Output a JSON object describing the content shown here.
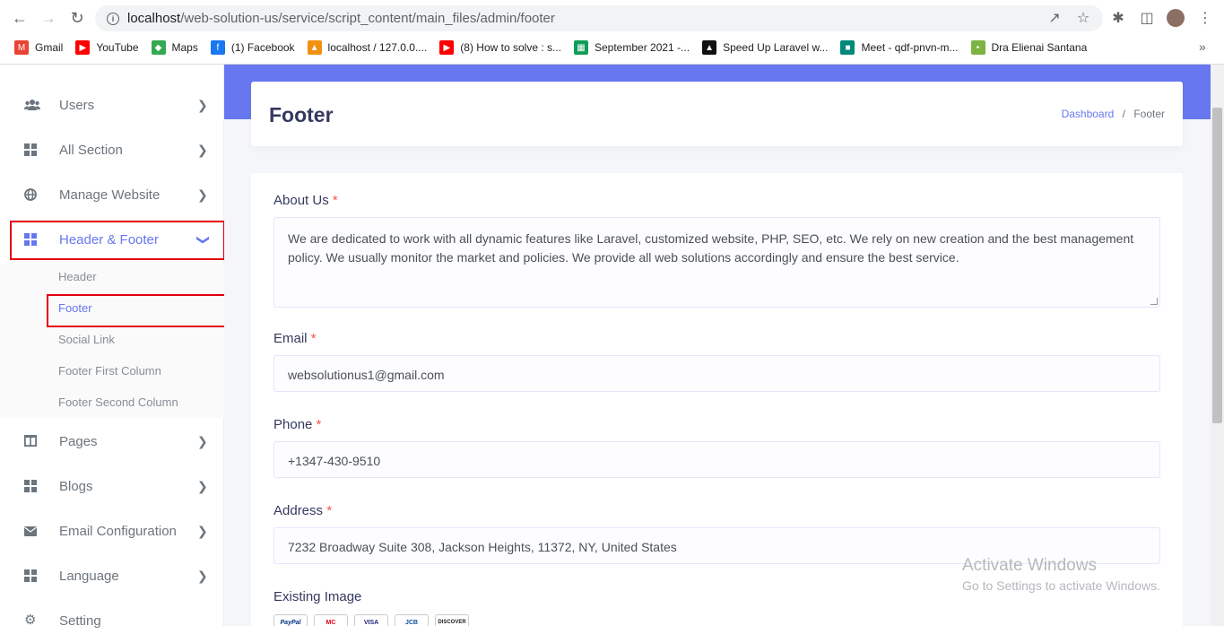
{
  "browser": {
    "url_host": "localhost",
    "url_path": "/web-solution-us/service/script_content/main_files/admin/footer",
    "bookmarks": [
      {
        "label": "Gmail",
        "icon": "gmail-icon",
        "color": "#ea4335"
      },
      {
        "label": "YouTube",
        "icon": "youtube-icon",
        "color": "#ff0000"
      },
      {
        "label": "Maps",
        "icon": "maps-icon",
        "color": "#34a853"
      },
      {
        "label": "(1) Facebook",
        "icon": "facebook-icon",
        "color": "#1877f2"
      },
      {
        "label": "localhost / 127.0.0....",
        "icon": "phpmyadmin-icon",
        "color": "#f29111"
      },
      {
        "label": "(8) How to solve : s...",
        "icon": "youtube-icon",
        "color": "#ff0000"
      },
      {
        "label": "September 2021 -...",
        "icon": "sheets-icon",
        "color": "#0f9d58"
      },
      {
        "label": "Speed Up Laravel w...",
        "icon": "laravel-icon",
        "color": "#111111"
      },
      {
        "label": "Meet - qdf-pnvn-m...",
        "icon": "meet-icon",
        "color": "#00897b"
      },
      {
        "label": "Dra Elienai Santana",
        "icon": "site-icon",
        "color": "#7cb342"
      }
    ],
    "more_bookmarks": "»"
  },
  "sidebar": {
    "items": [
      {
        "label": "Users",
        "icon": "users-icon"
      },
      {
        "label": "All Section",
        "icon": "grid-icon"
      },
      {
        "label": "Manage Website",
        "icon": "globe-icon"
      },
      {
        "label": "Header & Footer",
        "icon": "grid-icon"
      },
      {
        "label": "Pages",
        "icon": "columns-icon"
      },
      {
        "label": "Blogs",
        "icon": "grid-icon"
      },
      {
        "label": "Email Configuration",
        "icon": "envelope-icon"
      },
      {
        "label": "Language",
        "icon": "grid-icon"
      },
      {
        "label": "Setting",
        "icon": "gear-icon"
      }
    ],
    "submenu": [
      "Header",
      "Footer",
      "Social Link",
      "Footer First Column",
      "Footer Second Column"
    ]
  },
  "page": {
    "title": "Footer",
    "breadcrumb_home": "Dashboard",
    "breadcrumb_sep": "/",
    "breadcrumb_current": "Footer"
  },
  "form": {
    "about_label": "About Us",
    "about_value": "We are dedicated to work with all dynamic features like Laravel, customized website, PHP, SEO, etc.  We rely on new creation and the best management policy. We usually monitor the market and policies. We provide all web solutions accordingly and ensure the best service.",
    "email_label": "Email",
    "email_value": "websolutionus1@gmail.com",
    "phone_label": "Phone",
    "phone_value": "+1347-430-9510",
    "address_label": "Address",
    "address_value": "7232 Broadway Suite 308, Jackson Heights, 11372, NY, United States",
    "image_label": "Existing Image",
    "required_mark": "*",
    "card_logos": [
      "PayPal",
      "MC",
      "VISA",
      "JCB",
      "DISCOVER"
    ]
  },
  "watermark": {
    "line1": "Activate Windows",
    "line2": "Go to Settings to activate Windows."
  },
  "colors": {
    "accent": "#6777ef",
    "highlight_box": "#e3000f",
    "required": "#fc544b"
  }
}
